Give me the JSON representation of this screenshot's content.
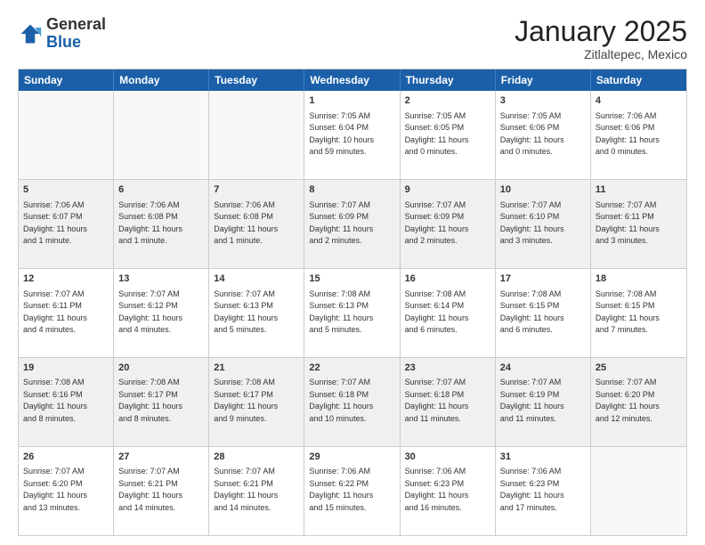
{
  "header": {
    "logo": {
      "general": "General",
      "blue": "Blue"
    },
    "month": "January 2025",
    "location": "Zitlaltepec, Mexico"
  },
  "days": [
    "Sunday",
    "Monday",
    "Tuesday",
    "Wednesday",
    "Thursday",
    "Friday",
    "Saturday"
  ],
  "weeks": [
    [
      {
        "day": "",
        "info": ""
      },
      {
        "day": "",
        "info": ""
      },
      {
        "day": "",
        "info": ""
      },
      {
        "day": "1",
        "info": "Sunrise: 7:05 AM\nSunset: 6:04 PM\nDaylight: 10 hours\nand 59 minutes."
      },
      {
        "day": "2",
        "info": "Sunrise: 7:05 AM\nSunset: 6:05 PM\nDaylight: 11 hours\nand 0 minutes."
      },
      {
        "day": "3",
        "info": "Sunrise: 7:05 AM\nSunset: 6:06 PM\nDaylight: 11 hours\nand 0 minutes."
      },
      {
        "day": "4",
        "info": "Sunrise: 7:06 AM\nSunset: 6:06 PM\nDaylight: 11 hours\nand 0 minutes."
      }
    ],
    [
      {
        "day": "5",
        "info": "Sunrise: 7:06 AM\nSunset: 6:07 PM\nDaylight: 11 hours\nand 1 minute."
      },
      {
        "day": "6",
        "info": "Sunrise: 7:06 AM\nSunset: 6:08 PM\nDaylight: 11 hours\nand 1 minute."
      },
      {
        "day": "7",
        "info": "Sunrise: 7:06 AM\nSunset: 6:08 PM\nDaylight: 11 hours\nand 1 minute."
      },
      {
        "day": "8",
        "info": "Sunrise: 7:07 AM\nSunset: 6:09 PM\nDaylight: 11 hours\nand 2 minutes."
      },
      {
        "day": "9",
        "info": "Sunrise: 7:07 AM\nSunset: 6:09 PM\nDaylight: 11 hours\nand 2 minutes."
      },
      {
        "day": "10",
        "info": "Sunrise: 7:07 AM\nSunset: 6:10 PM\nDaylight: 11 hours\nand 3 minutes."
      },
      {
        "day": "11",
        "info": "Sunrise: 7:07 AM\nSunset: 6:11 PM\nDaylight: 11 hours\nand 3 minutes."
      }
    ],
    [
      {
        "day": "12",
        "info": "Sunrise: 7:07 AM\nSunset: 6:11 PM\nDaylight: 11 hours\nand 4 minutes."
      },
      {
        "day": "13",
        "info": "Sunrise: 7:07 AM\nSunset: 6:12 PM\nDaylight: 11 hours\nand 4 minutes."
      },
      {
        "day": "14",
        "info": "Sunrise: 7:07 AM\nSunset: 6:13 PM\nDaylight: 11 hours\nand 5 minutes."
      },
      {
        "day": "15",
        "info": "Sunrise: 7:08 AM\nSunset: 6:13 PM\nDaylight: 11 hours\nand 5 minutes."
      },
      {
        "day": "16",
        "info": "Sunrise: 7:08 AM\nSunset: 6:14 PM\nDaylight: 11 hours\nand 6 minutes."
      },
      {
        "day": "17",
        "info": "Sunrise: 7:08 AM\nSunset: 6:15 PM\nDaylight: 11 hours\nand 6 minutes."
      },
      {
        "day": "18",
        "info": "Sunrise: 7:08 AM\nSunset: 6:15 PM\nDaylight: 11 hours\nand 7 minutes."
      }
    ],
    [
      {
        "day": "19",
        "info": "Sunrise: 7:08 AM\nSunset: 6:16 PM\nDaylight: 11 hours\nand 8 minutes."
      },
      {
        "day": "20",
        "info": "Sunrise: 7:08 AM\nSunset: 6:17 PM\nDaylight: 11 hours\nand 8 minutes."
      },
      {
        "day": "21",
        "info": "Sunrise: 7:08 AM\nSunset: 6:17 PM\nDaylight: 11 hours\nand 9 minutes."
      },
      {
        "day": "22",
        "info": "Sunrise: 7:07 AM\nSunset: 6:18 PM\nDaylight: 11 hours\nand 10 minutes."
      },
      {
        "day": "23",
        "info": "Sunrise: 7:07 AM\nSunset: 6:18 PM\nDaylight: 11 hours\nand 11 minutes."
      },
      {
        "day": "24",
        "info": "Sunrise: 7:07 AM\nSunset: 6:19 PM\nDaylight: 11 hours\nand 11 minutes."
      },
      {
        "day": "25",
        "info": "Sunrise: 7:07 AM\nSunset: 6:20 PM\nDaylight: 11 hours\nand 12 minutes."
      }
    ],
    [
      {
        "day": "26",
        "info": "Sunrise: 7:07 AM\nSunset: 6:20 PM\nDaylight: 11 hours\nand 13 minutes."
      },
      {
        "day": "27",
        "info": "Sunrise: 7:07 AM\nSunset: 6:21 PM\nDaylight: 11 hours\nand 14 minutes."
      },
      {
        "day": "28",
        "info": "Sunrise: 7:07 AM\nSunset: 6:21 PM\nDaylight: 11 hours\nand 14 minutes."
      },
      {
        "day": "29",
        "info": "Sunrise: 7:06 AM\nSunset: 6:22 PM\nDaylight: 11 hours\nand 15 minutes."
      },
      {
        "day": "30",
        "info": "Sunrise: 7:06 AM\nSunset: 6:23 PM\nDaylight: 11 hours\nand 16 minutes."
      },
      {
        "day": "31",
        "info": "Sunrise: 7:06 AM\nSunset: 6:23 PM\nDaylight: 11 hours\nand 17 minutes."
      },
      {
        "day": "",
        "info": ""
      }
    ]
  ]
}
